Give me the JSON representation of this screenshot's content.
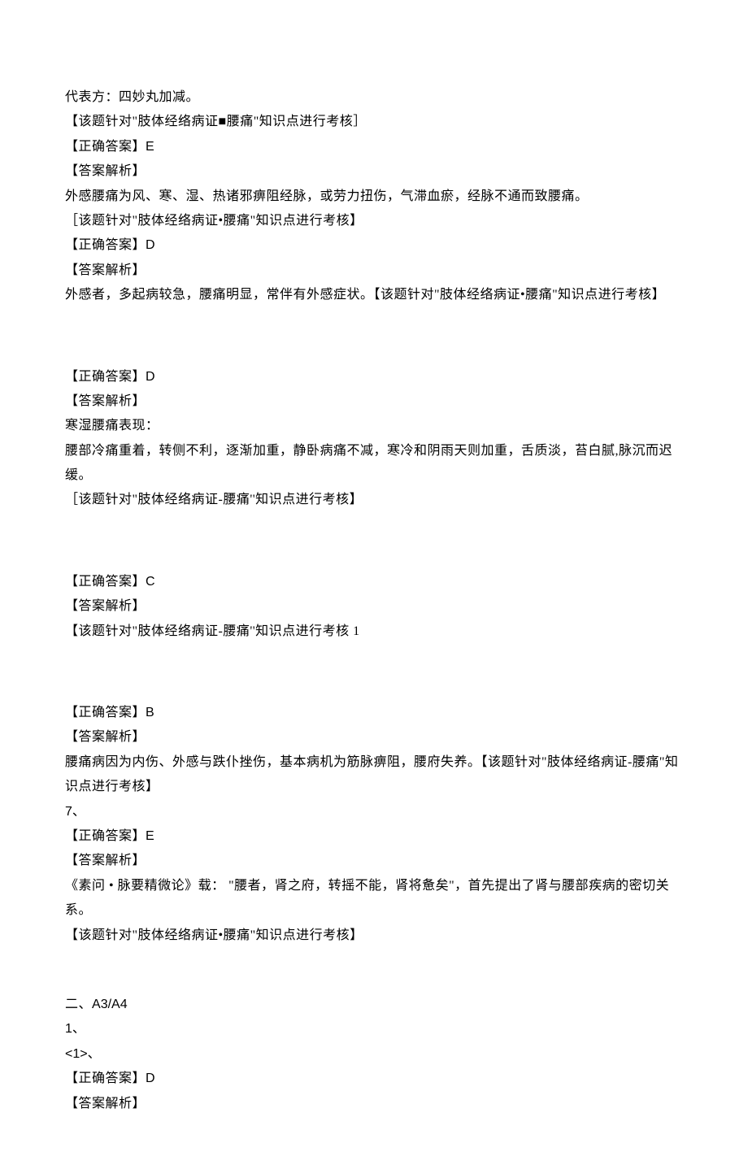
{
  "lines": {
    "l01": "代表方：四妙丸加减。",
    "l02": "【该题针对\"肢体经络病证■腰痛\"知识点进行考核］",
    "l03_a": "【正确答案】",
    "l03_b": "E",
    "l04": "【答案解析】",
    "l05": "外感腰痛为风、寒、湿、热诸邪痹阻经脉，或劳力扭伤，气滞血瘀，经脉不通而致腰痛。",
    "l06": "［该题针对\"肢体经络病证•腰痛\"知识点进行考核】",
    "l07_a": "【正确答案】",
    "l07_b": "D",
    "l08": "【答案解析】",
    "l09": "外感者，多起病较急，腰痛明显，常伴有外感症状。【该题针对\"肢体经络病证•腰痛\"知识点进行考核】",
    "l10_a": "【正确答案】",
    "l10_b": "D",
    "l11": "【答案解析】",
    "l12": "寒湿腰痛表现：",
    "l13": "腰部冷痛重着，转侧不利，逐渐加重，静卧病痛不减，寒冷和阴雨天则加重，舌质淡，苔白腻,脉沉而迟缓。",
    "l14": "［该题针对\"肢体经络病证-腰痛''知识点进行考核】",
    "l15_a": "【正确答案】",
    "l15_b": "C",
    "l16": "【答案解析】",
    "l17": "【该题针对\"肢体经络病证-腰痛''知识点进行考核 1",
    "l18_a": "【正确答案】",
    "l18_b": "B",
    "l19": "【答案解析】",
    "l20": "腰痛病因为内伤、外感与跌仆挫伤，基本病机为筋脉痹阻，腰府失养。【该题针对\"肢体经络病证-腰痛\"知识点进行考核】",
    "l21": "7、",
    "l22_a": "【正确答案】",
    "l22_b": "E",
    "l23": "【答案解析】",
    "l24": "《素问 • 脉要精微论》载：  \"腰者，肾之府，转摇不能，肾将惫矣\"，首先提出了肾与腰部疾病的密切关系。",
    "l25": "【该题针对\"肢体经络病证•腰痛\"知识点进行考核】",
    "l26_a": "二、",
    "l26_b": "A3/A4",
    "l27": "1、",
    "l28": "<1>、",
    "l29_a": "【正确答案】",
    "l29_b": "D",
    "l30": "【答案解析】"
  }
}
